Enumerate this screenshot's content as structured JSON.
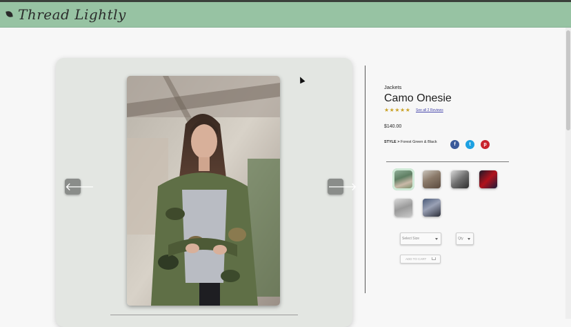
{
  "header": {
    "brand": "Thread Lightly",
    "logo_icon": "leaf-icon"
  },
  "gallery": {
    "prev_icon": "arrow-left-icon",
    "next_icon": "arrow-right-icon",
    "prev_glyph": "🡐",
    "next_glyph": "🡒"
  },
  "product": {
    "category": "Jackets",
    "title": "Camo Onesie",
    "rating_stars": "★★★★★",
    "rating_value": 4.5,
    "reviews_link": "See all 2 Reviews",
    "price": "$140.00",
    "style_label": "STYLE >",
    "style_value": "Forest Green & Black",
    "thumbnails": [
      "thumb-1",
      "thumb-2",
      "thumb-3",
      "thumb-4",
      "thumb-5",
      "thumb-6"
    ]
  },
  "social": {
    "facebook": "f",
    "twitter": "t",
    "pinterest": "p"
  },
  "form": {
    "size_placeholder": "Select Size",
    "qty_placeholder": "Qty",
    "add_to_cart": "ADD TO CART"
  },
  "colors": {
    "header_bg": "#97c3a3",
    "card_bg": "#e3e6e2",
    "star": "#c9a227",
    "facebook": "#3b5a9a",
    "twitter": "#1da1e2",
    "pinterest": "#c8232c"
  }
}
